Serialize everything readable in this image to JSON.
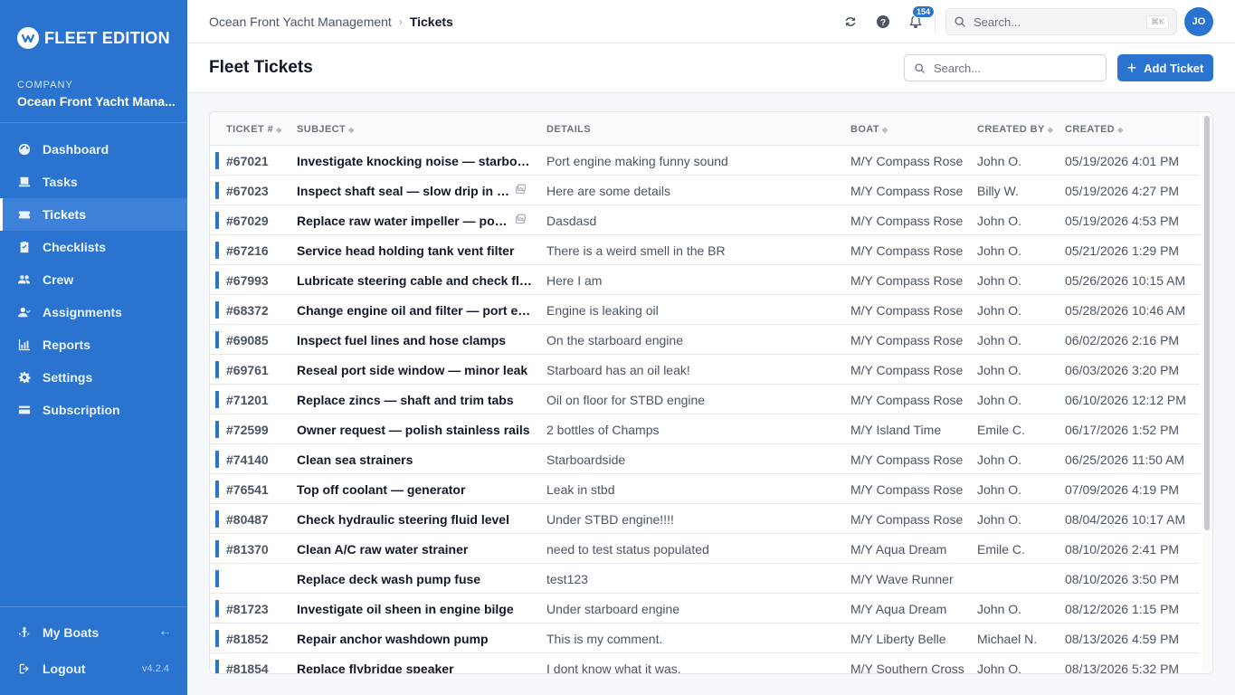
{
  "brand": {
    "name": "FLEET EDITION",
    "accent": "#2a74d0"
  },
  "company": {
    "label": "COMPANY",
    "name": "Ocean Front Yacht Mana..."
  },
  "nav": [
    {
      "label": "Dashboard",
      "icon": "dashboard-icon",
      "active": false
    },
    {
      "label": "Tasks",
      "icon": "tasks-icon",
      "active": false
    },
    {
      "label": "Tickets",
      "icon": "tickets-icon",
      "active": true
    },
    {
      "label": "Checklists",
      "icon": "checklist-icon",
      "active": false
    },
    {
      "label": "Crew",
      "icon": "crew-icon",
      "active": false
    },
    {
      "label": "Assignments",
      "icon": "assignments-icon",
      "active": false
    },
    {
      "label": "Reports",
      "icon": "reports-icon",
      "active": false
    },
    {
      "label": "Settings",
      "icon": "gear-icon",
      "active": false
    },
    {
      "label": "Subscription",
      "icon": "card-icon",
      "active": false
    }
  ],
  "sidebar_bottom": {
    "my_boats": "My Boats",
    "logout": "Logout",
    "version": "v4.2.4"
  },
  "topbar": {
    "breadcrumb_parent": "Ocean Front Yacht Management",
    "breadcrumb_current": "Tickets",
    "notification_count": "154",
    "search_placeholder": "Search...",
    "shortcut": "⌘K",
    "avatar_initials": "JO"
  },
  "page": {
    "title": "Fleet Tickets",
    "search_placeholder": "Search...",
    "add_button": "Add Ticket"
  },
  "table": {
    "columns": {
      "ticket": "TICKET #",
      "subject": "SUBJECT",
      "details": "DETAILS",
      "boat": "BOAT",
      "created_by": "CREATED BY",
      "created": "CREATED"
    },
    "rows": [
      {
        "num": "#67021",
        "subject": "Investigate knocking noise — starboard engine",
        "attachment": false,
        "details": "Port engine making funny sound",
        "boat": "M/Y Compass Rose",
        "by": "John O.",
        "created": "05/19/2026 4:01 PM"
      },
      {
        "num": "#67023",
        "subject": "Inspect shaft seal — slow drip in bilge",
        "attachment": true,
        "details": "Here are some details",
        "boat": "M/Y Compass Rose",
        "by": "Billy W.",
        "created": "05/19/2026 4:27 PM"
      },
      {
        "num": "#67029",
        "subject": "Replace raw water impeller — port engine",
        "attachment": true,
        "details": "Dasdasd",
        "boat": "M/Y Compass Rose",
        "by": "John O.",
        "created": "05/19/2026 4:53 PM"
      },
      {
        "num": "#67216",
        "subject": "Service head holding tank vent filter",
        "attachment": false,
        "details": "There is a weird smell in the BR",
        "boat": "M/Y Compass Rose",
        "by": "John O.",
        "created": "05/21/2026 1:29 PM"
      },
      {
        "num": "#67993",
        "subject": "Lubricate steering cable and check fluid",
        "attachment": false,
        "details": "Here I am",
        "boat": "M/Y Compass Rose",
        "by": "John O.",
        "created": "05/26/2026 10:15 AM"
      },
      {
        "num": "#68372",
        "subject": "Change engine oil and filter — port engine",
        "attachment": false,
        "details": "Engine is leaking oil",
        "boat": "M/Y Compass Rose",
        "by": "John O.",
        "created": "05/28/2026 10:46 AM"
      },
      {
        "num": "#69085",
        "subject": "Inspect fuel lines and hose clamps",
        "attachment": false,
        "details": "On the starboard engine",
        "boat": "M/Y Compass Rose",
        "by": "John O.",
        "created": "06/02/2026 2:16 PM"
      },
      {
        "num": "#69761",
        "subject": "Reseal port side window — minor leak",
        "attachment": false,
        "details": "Starboard has an oil leak!",
        "boat": "M/Y Compass Rose",
        "by": "John O.",
        "created": "06/03/2026 3:20 PM"
      },
      {
        "num": "#71201",
        "subject": "Replace zincs — shaft and trim tabs",
        "attachment": false,
        "details": "Oil on floor for STBD engine",
        "boat": "M/Y Compass Rose",
        "by": "John O.",
        "created": "06/10/2026 12:12 PM"
      },
      {
        "num": "#72599",
        "subject": "Owner request — polish stainless rails",
        "attachment": false,
        "details": "2 bottles of Champs",
        "boat": "M/Y Island Time",
        "by": "Emile C.",
        "created": "06/17/2026 1:52 PM"
      },
      {
        "num": "#74140",
        "subject": "Clean sea strainers",
        "attachment": false,
        "details": "Starboardside",
        "boat": "M/Y Compass Rose",
        "by": "John O.",
        "created": "06/25/2026 11:50 AM"
      },
      {
        "num": "#76541",
        "subject": "Top off coolant — generator",
        "attachment": false,
        "details": "Leak in stbd",
        "boat": "M/Y Compass Rose",
        "by": "John O.",
        "created": "07/09/2026 4:19 PM"
      },
      {
        "num": "#80487",
        "subject": "Check hydraulic steering fluid level",
        "attachment": false,
        "details": "Under STBD engine!!!!",
        "boat": "M/Y Compass Rose",
        "by": "John O.",
        "created": "08/04/2026 10:17 AM"
      },
      {
        "num": "#81370",
        "subject": "Clean A/C raw water strainer",
        "attachment": false,
        "details": "need to test status populated",
        "boat": "M/Y Aqua Dream",
        "by": "Emile C.",
        "created": "08/10/2026 2:41 PM"
      },
      {
        "num": "",
        "subject": "Replace deck wash pump fuse",
        "attachment": false,
        "details": "test123",
        "boat": "M/Y Wave Runner",
        "by": "",
        "created": "08/10/2026 3:50 PM"
      },
      {
        "num": "#81723",
        "subject": "Investigate oil sheen in engine bilge",
        "attachment": false,
        "details": "Under starboard engine",
        "boat": "M/Y Aqua Dream",
        "by": "John O.",
        "created": "08/12/2026 1:15 PM"
      },
      {
        "num": "#81852",
        "subject": "Repair anchor washdown pump",
        "attachment": false,
        "details": "This is my comment.",
        "boat": "M/Y Liberty Belle",
        "by": "Michael N.",
        "created": "08/13/2026 4:59 PM"
      },
      {
        "num": "#81854",
        "subject": "Replace flybridge speaker",
        "attachment": false,
        "details": "I dont know what it was.",
        "boat": "M/Y Southern Cross",
        "by": "John O.",
        "created": "08/13/2026 5:32 PM"
      }
    ]
  }
}
